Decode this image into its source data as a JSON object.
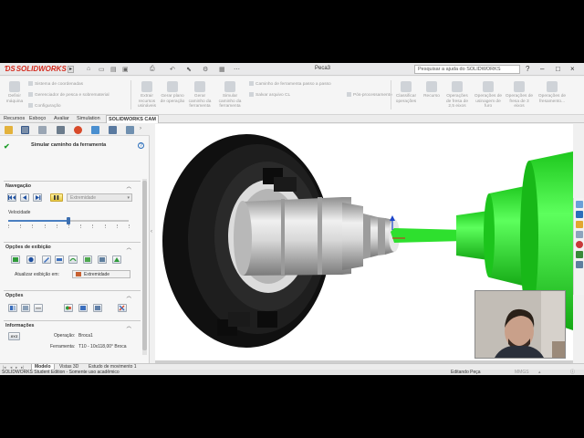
{
  "window": {
    "brand": "SOLIDWORKS",
    "document_title": "Peca3",
    "help_search_placeholder": "Pesquisar a ajuda do SOLIDWORKS",
    "controls": [
      "?",
      "–",
      "□",
      "×"
    ]
  },
  "command_manager": {
    "big_buttons": [
      "Definir máquina",
      "Extrair recursos usináveis",
      "Gerar plano de operação",
      "Gerar caminho da ferramenta",
      "Simular caminho da ferramenta",
      "Pós-processamento",
      "Classificar operações",
      "Recurso",
      "Operações de fresa de 2,5 eixos",
      "Operações de usinagem de furo",
      "Operações de fresa de 3 eixos",
      "Operações de fresamento..."
    ],
    "small_buttons": [
      "Sistema de coordenadas",
      "Gerenciador de pesca e sobrematerial",
      "Configuração",
      "Caminho de ferramenta passo a passo",
      "Salvar arquivo CL"
    ]
  },
  "tabs": [
    "Recursos",
    "Esboço",
    "Avaliar",
    "Simulation",
    "SOLIDWORKS CAM"
  ],
  "active_tab": "SOLIDWORKS CAM",
  "property_manager": {
    "title": "Simular caminho da ferramenta",
    "ok_symbol": "✔",
    "help_symbol": "?",
    "navegacao": {
      "heading": "Navegação",
      "mode_value": "Extremidade",
      "velocidade_label": "Velocidade",
      "speed_fraction": 0.5
    },
    "opcoes_exibicao": {
      "heading": "Opções de exibição",
      "update_label": "Atualizar exibição em:",
      "update_value": "Extremidade"
    },
    "opcoes": {
      "heading": "Opções"
    },
    "informacoes": {
      "heading": "Informações",
      "xyz_label": "XYZ",
      "operacao_label": "Operação:",
      "operacao_value": "Broca1",
      "ferramenta_label": "Ferramenta:",
      "ferramenta_value": "T10 - 10x118,00° Broca"
    }
  },
  "bottom_tabs": [
    "Modelo",
    "Vistas 3D",
    "Estudo de movimento 1"
  ],
  "active_bottom_tab": "Modelo",
  "status": {
    "edition": "SOLIDWORKS Student Edition - Somente uso acadêmico",
    "state": "Editando Peça",
    "units": "MMGS"
  },
  "colors": {
    "brand_red": "#d52b1e",
    "tool_green": "#22e022",
    "chuck_black": "#151515",
    "part_silver": "#c9c9c9",
    "accent_blue": "#2a6ebb"
  }
}
